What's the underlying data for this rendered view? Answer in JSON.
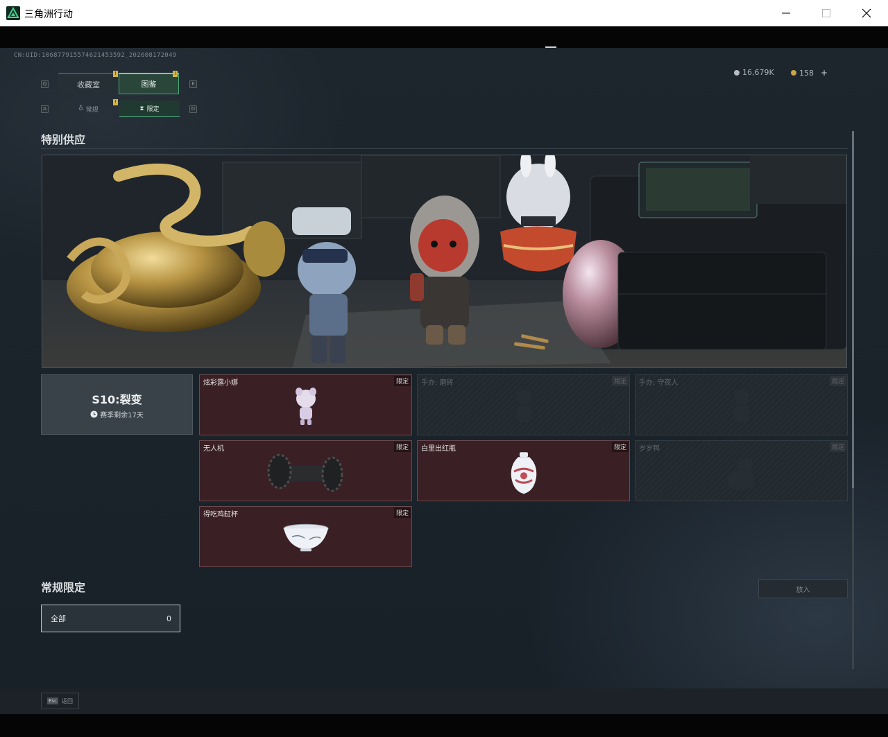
{
  "window": {
    "title": "三角洲行动",
    "icon": "delta-logo-icon",
    "controls": [
      "minimize-icon",
      "maximize-icon",
      "close-icon"
    ]
  },
  "header": {
    "uid": "CN:UID:10687791557462145359​2_202608172049"
  },
  "currencies": [
    {
      "icon": "silver-coin-icon",
      "value": "16,679K",
      "color": "#b8bdc2"
    },
    {
      "icon": "gold-coin-icon",
      "value": "158",
      "color": "#c9a646",
      "action": "+"
    }
  ],
  "nav": {
    "main_tabs": [
      {
        "label": "收藏室",
        "key": "Q",
        "active": false
      },
      {
        "label": "图鉴",
        "key": "E",
        "active": true
      }
    ],
    "sub_tabs": [
      {
        "label": "常规",
        "key": "A",
        "active": false
      },
      {
        "label": "限定",
        "key": "D",
        "active": true
      }
    ],
    "badge": "!"
  },
  "special_supply": {
    "title": "特别供应",
    "season": {
      "name": "S10:裂变",
      "remaining": "赛季剩余17天"
    },
    "items": [
      {
        "name": "炫彩露小娜",
        "tag": "限定",
        "owned": true,
        "art": "figurine"
      },
      {
        "name": "手办: 磨砖",
        "tag": "限定",
        "owned": false,
        "art": "figure-silhouette"
      },
      {
        "name": "手办: 守夜人",
        "tag": "限定",
        "owned": false,
        "art": "figure-silhouette"
      },
      {
        "name": "无人机",
        "tag": "限定",
        "owned": true,
        "art": "drone"
      },
      {
        "name": "白里出红瓶",
        "tag": "限定",
        "owned": true,
        "art": "vase"
      },
      {
        "name": "岁岁鸭",
        "tag": "限定",
        "owned": false,
        "art": "duck-silhouette"
      },
      {
        "name": "得吃鸡缸杯",
        "tag": "限定",
        "owned": true,
        "art": "bowl"
      }
    ]
  },
  "regular_limited": {
    "title": "常规限定",
    "filter": {
      "label": "全部",
      "count": "0"
    },
    "put_in_label": "放入"
  },
  "footer": {
    "esc_key": "Esc",
    "esc_label": "返回"
  },
  "colors": {
    "accent_green": "#6fd39b",
    "owned_card": "#3a1f24",
    "badge_yellow": "#d2b54a"
  }
}
